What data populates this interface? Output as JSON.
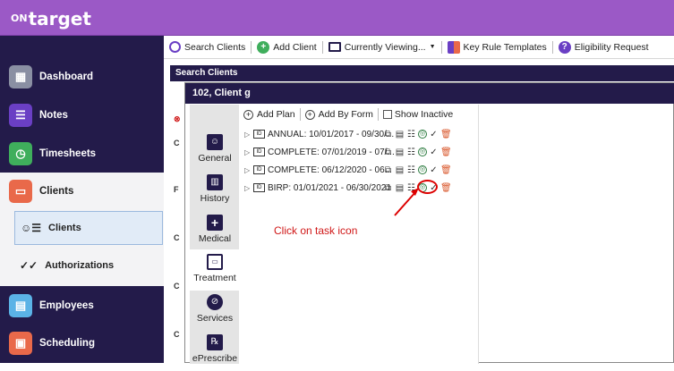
{
  "app": {
    "logo_prefix": "ON",
    "logo_main": "target"
  },
  "sidebar": {
    "items": [
      {
        "label": "Dashboard",
        "color": "#8a8fa3"
      },
      {
        "label": "Notes",
        "color": "#6a3fc4"
      },
      {
        "label": "Timesheets",
        "color": "#3fae5c"
      },
      {
        "label": "Clients",
        "color": "#e9694a"
      },
      {
        "label": "Employees",
        "color": "#5bb3e6"
      },
      {
        "label": "Scheduling",
        "color": "#e9694a"
      }
    ],
    "sub_items": [
      {
        "label": "Clients"
      },
      {
        "label": "Authorizations"
      }
    ]
  },
  "toolbar": {
    "search_clients": "Search Clients",
    "add_client": "Add Client",
    "currently_viewing": "Currently Viewing...",
    "key_rule_templates": "Key Rule Templates",
    "eligibility_request": "Eligibility Request"
  },
  "search_panel": {
    "title": "Search Clients"
  },
  "modal": {
    "title": "102, Client g",
    "tabs": [
      {
        "label": "General"
      },
      {
        "label": "History"
      },
      {
        "label": "Medical"
      },
      {
        "label": "Treatment"
      },
      {
        "label": "Services"
      },
      {
        "label": "ePrescribe"
      }
    ],
    "add_plan": "Add Plan",
    "add_by_form": "Add By Form",
    "show_inactive": "Show Inactive",
    "plans": [
      {
        "label": "ANNUAL: 10/01/2017 - 09/30/..."
      },
      {
        "label": "COMPLETE: 07/01/2019 - 07/..."
      },
      {
        "label": "COMPLETE: 06/12/2020 - 06..."
      },
      {
        "label": "BIRP: 01/01/2021 - 06/30/2021"
      }
    ]
  },
  "annotation": {
    "text": "Click on task icon",
    "color": "#d01818"
  }
}
